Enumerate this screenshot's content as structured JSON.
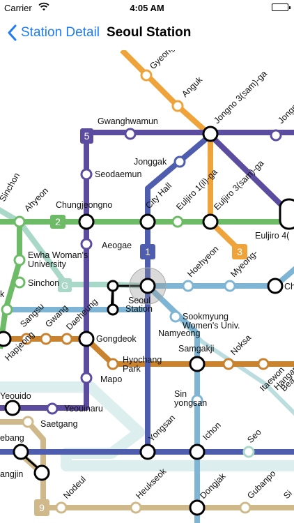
{
  "status_bar": {
    "carrier": "Carrier",
    "time": "4:05 AM"
  },
  "nav": {
    "back_label": "Station Detail",
    "title": "Seoul Station"
  },
  "colors": {
    "line1": "#4F5DAF",
    "line2": "#6EBB67",
    "line3": "#EFA43B",
    "line4": "#7FB5D4",
    "line5": "#5C4CA0",
    "line6": "#C9822D",
    "line9": "#CFB98B",
    "gyeongui": "#A9D7C8",
    "airport": "#BDE0E0",
    "back_blue": "#1E7CF5"
  },
  "line_badges": {
    "l1": "1",
    "l2": "2",
    "l3": "3",
    "l5": "5",
    "l9": "9",
    "lg": "G"
  },
  "stations": {
    "gyeong": "Gyeong",
    "anguk": "Anguk",
    "jongno3": "Jongno 3(sam)-ga",
    "jongno_r": "Jongn",
    "gwanghwamun": "Gwanghwamun",
    "jonggak": "Jonggak",
    "seodaemun": "Seodaemun",
    "sinchon_gy": "Sinchon\n(Gyeongui)",
    "ahyeon": "Ahyeon",
    "chungjeongno": "Chungjeongno",
    "city_hall": "City Hall",
    "euljiro1": "Euljiro 1(il)-ga",
    "euljiro3": "Euljiro 3(sam)-ga",
    "euljiro4": "Euljiro 4(",
    "aeogae": "Aeogae",
    "ewha": "Ewha Woman's\nUniversity",
    "sinchon": "Sinchon",
    "hoehyeon": "Hoehyeon",
    "myeongdong": "Myeong-\ndong",
    "ch_r": "Ch",
    "seoul_station": "Seoul\nStation",
    "sangsu": "Sangsu",
    "gwangheungchang": "Gwang\nheungchang",
    "daeheung": "Daeheung",
    "sookmyung": "Sookmyung\nWomen's Univ.",
    "namyeong": "Namyeong",
    "gongdeok": "Gongdeok",
    "samgakji": "Samgakji",
    "noksapyeong": "Noksa\npyeong",
    "hapjeong": "Hapjeong",
    "hyochang": "Hyochang\nPark",
    "mapo": "Mapo",
    "itaewon": "Itaewon",
    "hangangjin": "Hangangjin",
    "be_r": "Bea",
    "sinyongsan": "Sin\nyongsan",
    "yeouido": "Yeouido",
    "yeouinaru": "Yeouinaru",
    "saetgang": "Saetgang",
    "seobinggo": "Seo\nbinggo",
    "ebang": "ebang",
    "yongsan": "Yongsan",
    "ichon": "Ichon",
    "angjin": "angjin",
    "nodeul": "Nodeul",
    "heukseok": "Heukseok",
    "dongjak": "Dongjak",
    "gubanpo": "Gubanpo",
    "s_r": "Si",
    "dong_l": "ong",
    "kl": "k"
  }
}
